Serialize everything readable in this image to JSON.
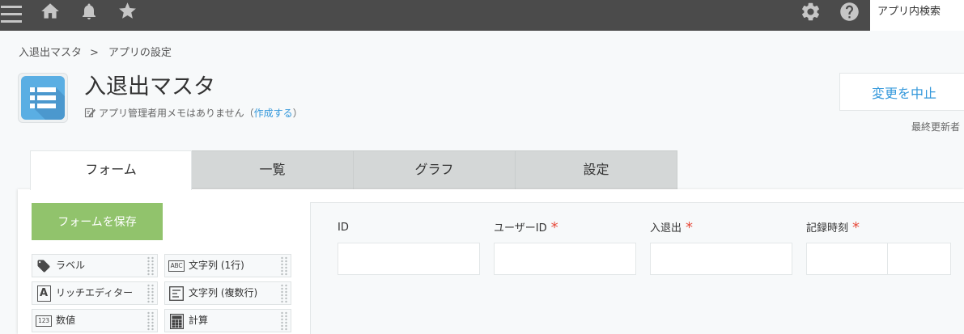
{
  "header": {
    "left_icons": [
      "menu-icon",
      "home-icon",
      "bell-icon",
      "star-icon"
    ],
    "right_icons": [
      "gear-icon",
      "help-icon"
    ],
    "search": {
      "placeholder": "アプリ内検索",
      "value": ""
    }
  },
  "breadcrumb": {
    "app": "入退出マスタ",
    "separator": ">",
    "current": "アプリの設定"
  },
  "app": {
    "icon": "list-icon",
    "name": "入退出マスタ",
    "memo_icon": "memo-edit-icon",
    "memo_text": "アプリ管理者用メモはありません",
    "memo_open": "（",
    "memo_link": "作成する",
    "memo_close": "）"
  },
  "actions": {
    "cancel_label": "変更を中止",
    "last_updated_label": "最終更新者"
  },
  "tabs": [
    {
      "label": "フォーム",
      "active": true
    },
    {
      "label": "一覧",
      "active": false
    },
    {
      "label": "グラフ",
      "active": false
    },
    {
      "label": "設定",
      "active": false
    }
  ],
  "sidebar": {
    "save_label": "フォームを保存",
    "palette": [
      {
        "label": "ラベル",
        "icon": "tag-icon"
      },
      {
        "label": "文字列 (1行)",
        "icon": "single-line-text-icon",
        "glyph": "ABC"
      },
      {
        "label": "リッチエディター",
        "icon": "rich-editor-icon",
        "glyph": "A"
      },
      {
        "label": "文字列 (複数行)",
        "icon": "multi-line-text-icon"
      },
      {
        "label": "数値",
        "icon": "number-icon",
        "glyph": "123"
      },
      {
        "label": "計算",
        "icon": "calculator-icon"
      }
    ]
  },
  "form": {
    "required_mark": "*",
    "fields": [
      {
        "label": "ID",
        "required": false,
        "value": ""
      },
      {
        "label": "ユーザーID",
        "required": true,
        "value": ""
      },
      {
        "label": "入退出",
        "required": true,
        "value": ""
      },
      {
        "label": "記録時刻",
        "required": true,
        "date_value": "",
        "time_value": ""
      }
    ]
  },
  "colors": {
    "header_bg": "#4b4b4b",
    "header_icon": "#c6c6c6",
    "link": "#3498db",
    "save_button": "#91c36c",
    "required": "#e74c3c",
    "app_icon": "#5aaee3"
  }
}
